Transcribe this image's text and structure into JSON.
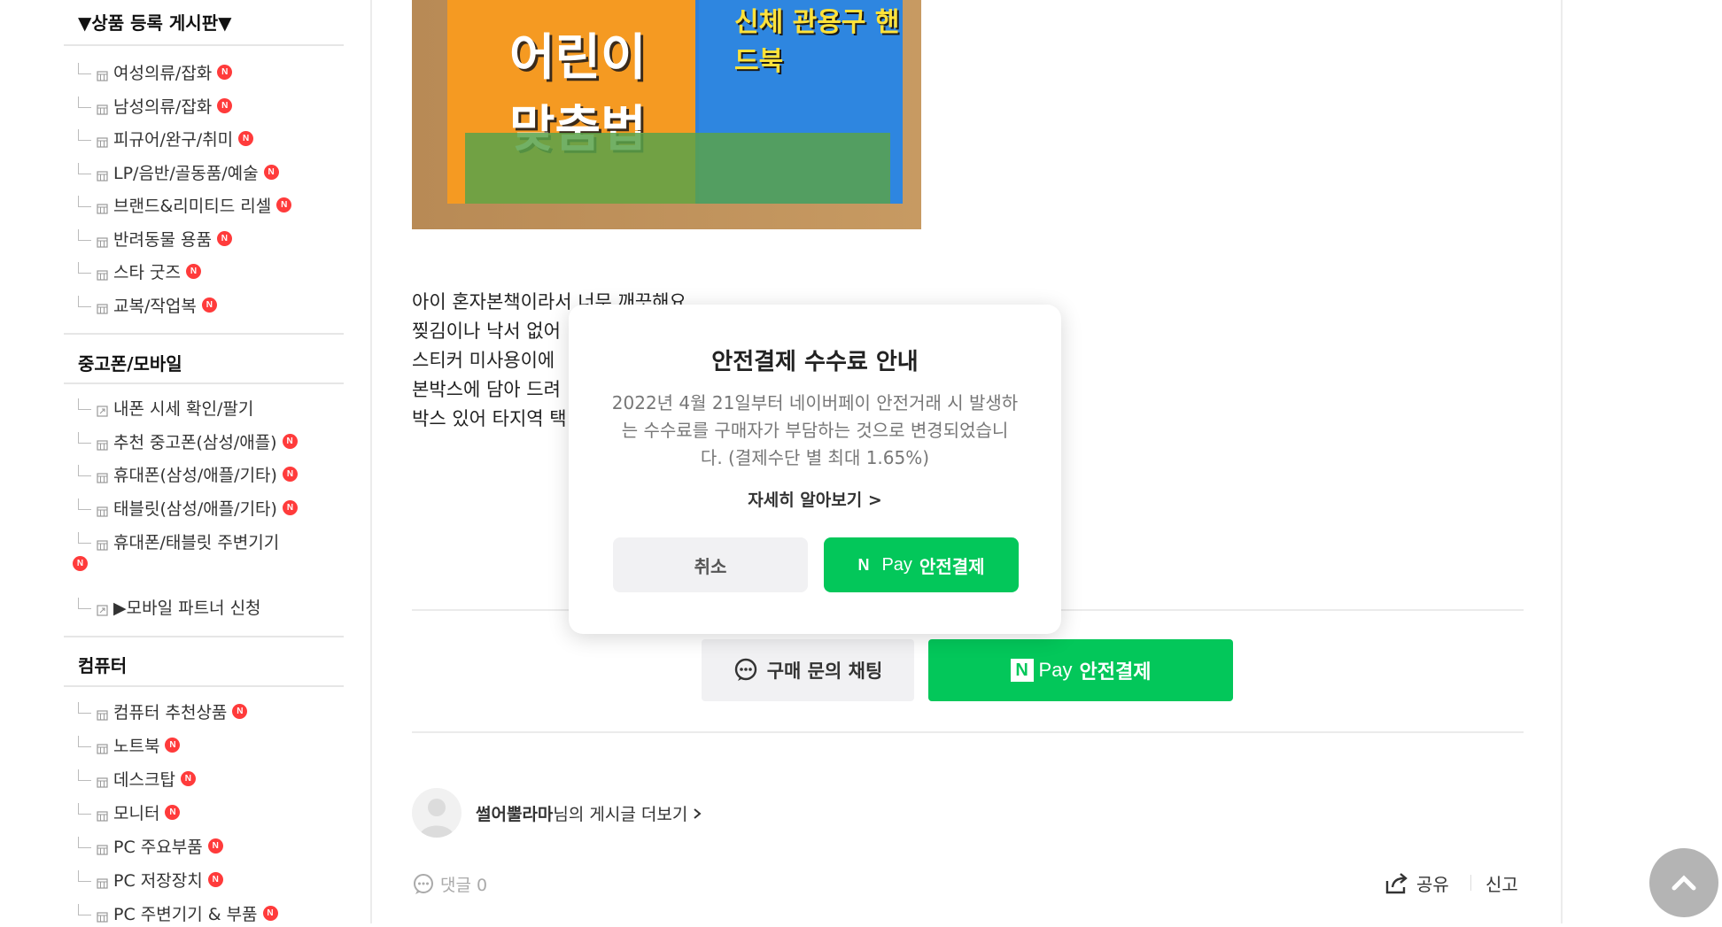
{
  "sidebar": {
    "sections": [
      {
        "title": "▼상품 등록 게시판▼",
        "items": [
          {
            "label": "여성의류/잡화",
            "new": true
          },
          {
            "label": "남성의류/잡화",
            "new": true
          },
          {
            "label": "피규어/완구/취미",
            "new": true
          },
          {
            "label": "LP/음반/골동품/예술",
            "new": true
          },
          {
            "label": "브랜드&리미티드 리셀",
            "new": true
          },
          {
            "label": "반려동물 용품",
            "new": true
          },
          {
            "label": "스타 굿즈",
            "new": true
          },
          {
            "label": "교복/작업복",
            "new": true
          }
        ]
      },
      {
        "title": "중고폰/모바일",
        "items": [
          {
            "label": "내폰 시세 확인/팔기",
            "new": false
          },
          {
            "label": "추천 중고폰(삼성/애플)",
            "new": true
          },
          {
            "label": "휴대폰(삼성/애플/기타)",
            "new": true
          },
          {
            "label": "태블릿(삼성/애플/기타)",
            "new": true
          },
          {
            "label": "휴대폰/태블릿 주변기기",
            "new": true
          },
          {
            "label": "▶모바일 파트너 신청",
            "new": false
          }
        ]
      },
      {
        "title": "컴퓨터",
        "items": [
          {
            "label": "컴퓨터 추천상품",
            "new": true
          },
          {
            "label": "노트북",
            "new": true
          },
          {
            "label": "데스크탑",
            "new": true
          },
          {
            "label": "모니터",
            "new": true
          },
          {
            "label": "PC 주요부품",
            "new": true
          },
          {
            "label": "PC 저장장치",
            "new": true
          },
          {
            "label": "PC 주변기기 & 부품",
            "new": true
          }
        ]
      }
    ],
    "new_badge": "N"
  },
  "post": {
    "photo_titles": {
      "left": "어린이 맞춤법",
      "right": "신체 관용구 핸드북"
    },
    "body_lines": [
      "아이 혼자본책이라서 너무 깨끗해요",
      "찢김이나 낙서 없어",
      "스티커 미사용이에",
      "본박스에 담아 드려",
      "박스 있어 타지역 택"
    ],
    "chat_button": "구매 문의 채팅",
    "pay_button": {
      "n": "N",
      "pay": "Pay",
      "label": "안전결제"
    },
    "author": {
      "name": "썰어뿔라마",
      "suffix": "님의 게시글 더보기"
    },
    "comment": "댓글 0",
    "share": "공유",
    "report": "신고"
  },
  "modal": {
    "title": "안전결제 수수료 안내",
    "description": "2022년 4월 21일부터 네이버페이 안전거래 시 발생하는 수수료를 구매자가 부담하는 것으로 변경되었습니다. (결제수단 별 최대 1.65%)",
    "more_link": "자세히 알아보기 >",
    "cancel": "취소",
    "confirm": {
      "n": "N",
      "pay": "Pay",
      "label": "안전결제"
    }
  },
  "colors": {
    "accent": "#03c75a",
    "badge": "#ff3b3b"
  },
  "icons": [
    "chat-bubble-icon",
    "share-icon",
    "comment-icon",
    "chevron-up-icon",
    "board-icon",
    "avatar-icon"
  ]
}
